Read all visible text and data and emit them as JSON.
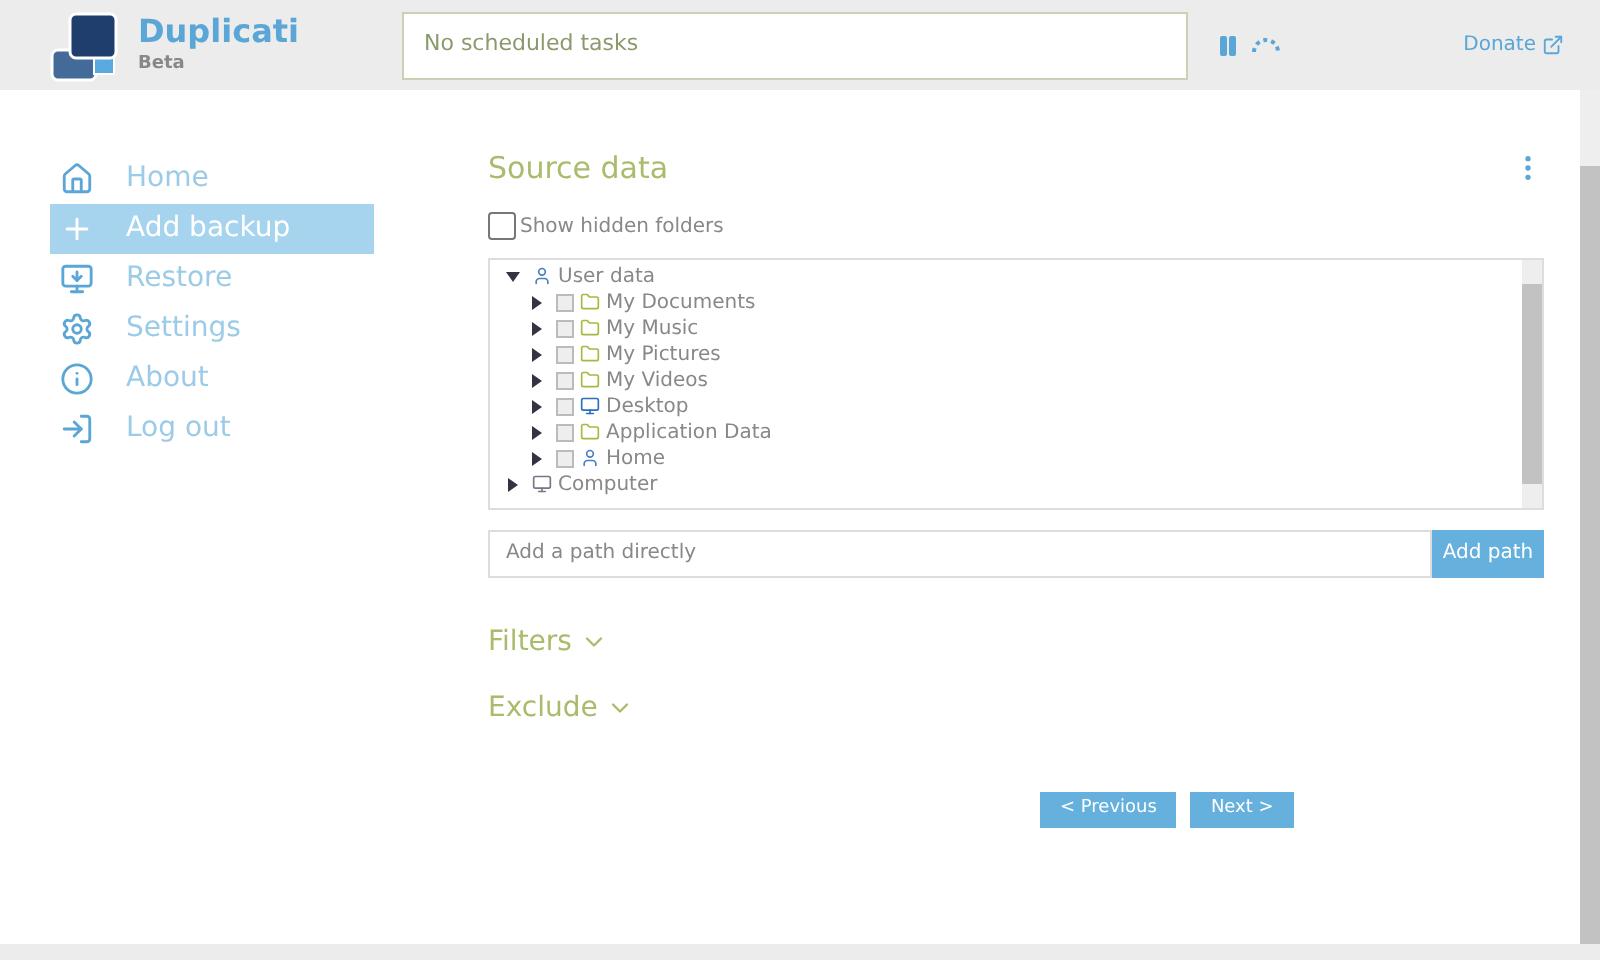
{
  "header": {
    "app_name": "Duplicati",
    "edition": "Beta",
    "status": "No scheduled tasks",
    "donate": "Donate"
  },
  "sidebar": {
    "items": [
      {
        "label": "Home",
        "selected": false
      },
      {
        "label": "Add backup",
        "selected": true
      },
      {
        "label": "Restore",
        "selected": false
      },
      {
        "label": "Settings",
        "selected": false
      },
      {
        "label": "About",
        "selected": false
      },
      {
        "label": "Log out",
        "selected": false
      }
    ]
  },
  "source": {
    "title": "Source data",
    "show_hidden": {
      "label": "Show hidden folders",
      "checked": false
    },
    "tree": [
      {
        "label": "User data",
        "expanded": true,
        "children": [
          {
            "label": "My Documents",
            "expanded": false,
            "checked": false
          },
          {
            "label": "My Music",
            "expanded": false,
            "checked": false
          },
          {
            "label": "My Pictures",
            "expanded": false,
            "checked": false
          },
          {
            "label": "My Videos",
            "expanded": false,
            "checked": false
          },
          {
            "label": "Desktop",
            "expanded": false,
            "checked": false
          },
          {
            "label": "Application Data",
            "expanded": false,
            "checked": false
          },
          {
            "label": "Home",
            "expanded": false,
            "checked": false
          }
        ]
      },
      {
        "label": "Computer",
        "expanded": false
      }
    ],
    "path_placeholder": "Add a path directly",
    "add_path": "Add path"
  },
  "sections": [
    {
      "label": "Filters",
      "expanded": false
    },
    {
      "label": "Exclude",
      "expanded": false
    }
  ],
  "buttons": {
    "previous": "< Previous",
    "next": "Next >"
  }
}
